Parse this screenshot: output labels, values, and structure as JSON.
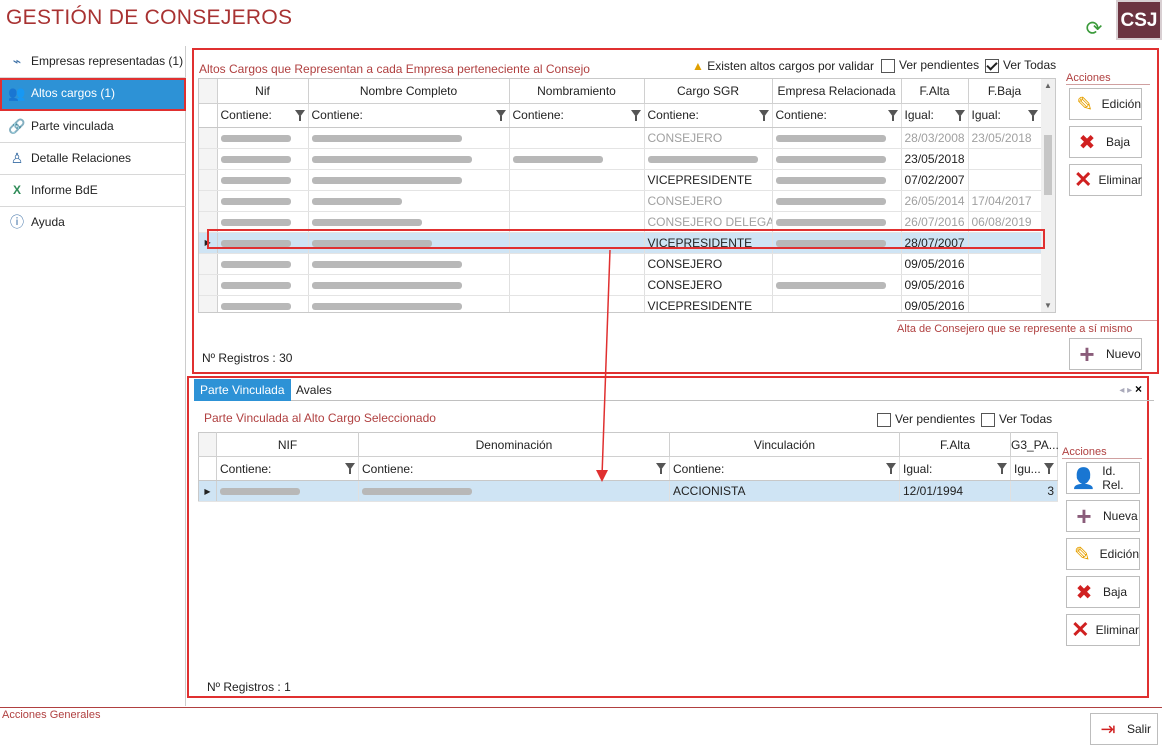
{
  "app": {
    "title": "GESTIÓN DE CONSEJEROS",
    "logo": "CSJ",
    "refresh_icon": "refresh-icon"
  },
  "sidebar": {
    "items": [
      {
        "label": "Empresas representadas (1)",
        "icon": "chart-icon"
      },
      {
        "label": "Altos cargos (1)",
        "icon": "users-icon",
        "active": true
      },
      {
        "label": "Parte vinculada",
        "icon": "link-icon"
      },
      {
        "label": "Detalle Relaciones",
        "icon": "person-icon"
      },
      {
        "label": "Informe BdE",
        "icon": "excel-icon"
      },
      {
        "label": "Ayuda",
        "icon": "help-icon"
      }
    ]
  },
  "top": {
    "section_title": "Altos Cargos que Representan a cada Empresa perteneciente al Consejo",
    "warning": "Existen altos cargos por validar",
    "ver_pendientes": "Ver pendientes",
    "ver_todas": "Ver Todas",
    "columns": [
      "Nif",
      "Nombre Completo",
      "Nombramiento",
      "Cargo SGR",
      "Empresa Relacionada",
      "F.Alta",
      "F.Baja"
    ],
    "filters": [
      "Contiene:",
      "Contiene:",
      "Contiene:",
      "Contiene:",
      "Contiene:",
      "Igual:",
      "Igual:"
    ],
    "rows": [
      {
        "cargo": "CONSEJERO",
        "alta": "28/03/2008",
        "baja": "23/05/2018",
        "dim": true
      },
      {
        "cargo": "",
        "alta": "23/05/2018",
        "baja": "",
        "dim": false
      },
      {
        "cargo": "VICEPRESIDENTE",
        "alta": "07/02/2007",
        "baja": "",
        "dim": false
      },
      {
        "cargo": "CONSEJERO",
        "alta": "26/05/2014",
        "baja": "17/04/2017",
        "dim": true
      },
      {
        "cargo": "CONSEJERO DELEGADO",
        "alta": "26/07/2016",
        "baja": "06/08/2019",
        "dim": true
      },
      {
        "cargo": "VICEPRESIDENTE",
        "alta": "28/07/2007",
        "baja": "",
        "dim": false,
        "selected": true
      },
      {
        "cargo": "CONSEJERO",
        "alta": "09/05/2016",
        "baja": "",
        "dim": false
      },
      {
        "cargo": "CONSEJERO",
        "alta": "09/05/2016",
        "baja": "",
        "dim": false
      },
      {
        "cargo": "VICEPRESIDENTE",
        "alta": "09/05/2016",
        "baja": "",
        "dim": false
      }
    ],
    "registros": "Nº Registros : 30",
    "acciones_label": "Acciones",
    "actions": [
      "Edición",
      "Baja",
      "Eliminar"
    ],
    "alta_label": "Alta de Consejero que se represente a sí mismo",
    "nuevo": "Nuevo"
  },
  "bottom": {
    "tabs": [
      "Parte Vinculada",
      "Avales"
    ],
    "section_title": "Parte Vinculada al Alto Cargo Seleccionado",
    "ver_pendientes": "Ver pendientes",
    "ver_todas": "Ver Todas",
    "columns": [
      "NIF",
      "Denominación",
      "Vinculación",
      "F.Alta",
      "G3_PA..."
    ],
    "filters": [
      "Contiene:",
      "Contiene:",
      "Contiene:",
      "Igual:",
      "Igu..."
    ],
    "rows": [
      {
        "vinculacion": "ACCIONISTA",
        "alta": "12/01/1994",
        "g3": "3"
      }
    ],
    "registros": "Nº Registros : 1",
    "acciones_label": "Acciones",
    "actions": [
      "Id. Rel.",
      "Nueva",
      "Edición",
      "Baja",
      "Eliminar"
    ]
  },
  "footer": {
    "acciones_generales": "Acciones Generales",
    "salir": "Salir"
  },
  "colors": {
    "brand": "#a83232",
    "accent": "#2d92d6",
    "highlight": "#e03030",
    "selection": "#cfe4f4"
  }
}
